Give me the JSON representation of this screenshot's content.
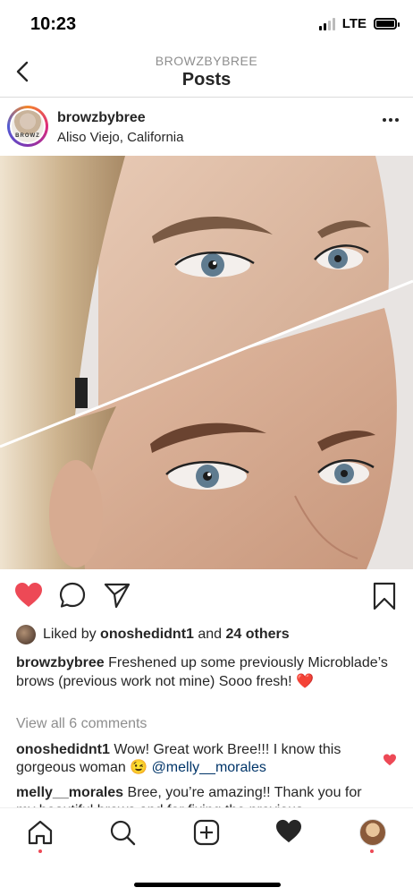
{
  "status_bar": {
    "time": "10:23",
    "network": "LTE"
  },
  "nav": {
    "subtitle": "BROWZBYBREE",
    "title": "Posts"
  },
  "post": {
    "username": "browzbybree",
    "location": "Aliso Viejo, California",
    "avatar_text": "BROWZ",
    "liked_by_prefix": "Liked by ",
    "liked_by_user": "onoshedidnt1",
    "liked_by_and": " and ",
    "liked_by_others": "24 others",
    "caption_user": "browzbybree",
    "caption_text": " Freshened up some previously Microblade’s brows (previous work not mine) Sooo fresh! ❤️",
    "view_all_comments": "View all 6 comments",
    "comments": [
      {
        "user": "onoshedidnt1",
        "text": " Wow! Great work Bree!!! I know this gorgeous woman 😉 ",
        "mention": "@melly__morales"
      },
      {
        "user": "melly__morales",
        "text": " Bree, you’re amazing!! Thank you for my beautiful brows and for fixing the previous..."
      }
    ]
  },
  "colors": {
    "like_red": "#ed4956",
    "text": "#262626",
    "muted": "#8e8e8e",
    "mention": "#003569"
  },
  "icons": [
    "back-chevron-icon",
    "more-dots-icon",
    "heart-filled-icon",
    "comment-icon",
    "share-icon",
    "bookmark-icon",
    "home-icon",
    "search-icon",
    "add-post-icon",
    "activity-heart-icon",
    "profile-avatar-icon"
  ]
}
